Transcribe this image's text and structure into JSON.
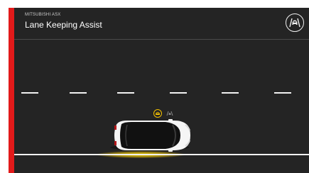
{
  "header": {
    "brand": "MITSUBISHI ASX",
    "title": "Lane Keeping Assist"
  },
  "icons": {
    "header_button": "lane-keeping-car-icon",
    "indicator_active": "lane-assist-active-icon",
    "indicator_inactive": "lane-assist-inactive-icon"
  },
  "colors": {
    "accent": "#e21a1a",
    "screen_background": "#242424",
    "lane_markings": "#f2f2f2",
    "lane_warning_glow": "#ffd400",
    "indicator_active": "#f3c000",
    "car_body": "#f5f5f5",
    "car_roof": "#111111"
  }
}
